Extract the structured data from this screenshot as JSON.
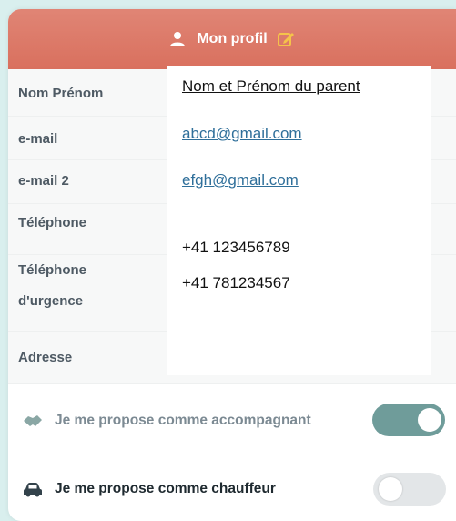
{
  "header": {
    "title": "Mon profil",
    "user_icon": "user-icon",
    "edit_icon": "edit-icon",
    "color": "#d9705e"
  },
  "fields": {
    "name_label": "Nom Prénom",
    "name_value": "Nom et Prénom du parent",
    "email_label": "e-mail",
    "email_value": "abcd@gmail.com",
    "email2_label": "e-mail 2",
    "email2_value": "efgh@gmail.com",
    "phone_label": "Téléphone",
    "phone_value": "+41 123456789",
    "emergency_label_1": "Téléphone",
    "emergency_label_2": "d'urgence",
    "emergency_value": "+41 781234567",
    "address_label": "Adresse"
  },
  "toggles": {
    "accompagnant_label": "Je me propose comme accompagnant",
    "accompagnant_on": true,
    "accompagnant_icon": "handshake-icon",
    "chauffeur_label": "Je me propose comme chauffeur",
    "chauffeur_on": false,
    "chauffeur_icon": "car-icon",
    "on_color": "#6f9c9a",
    "off_color": "#e3e6e8"
  }
}
